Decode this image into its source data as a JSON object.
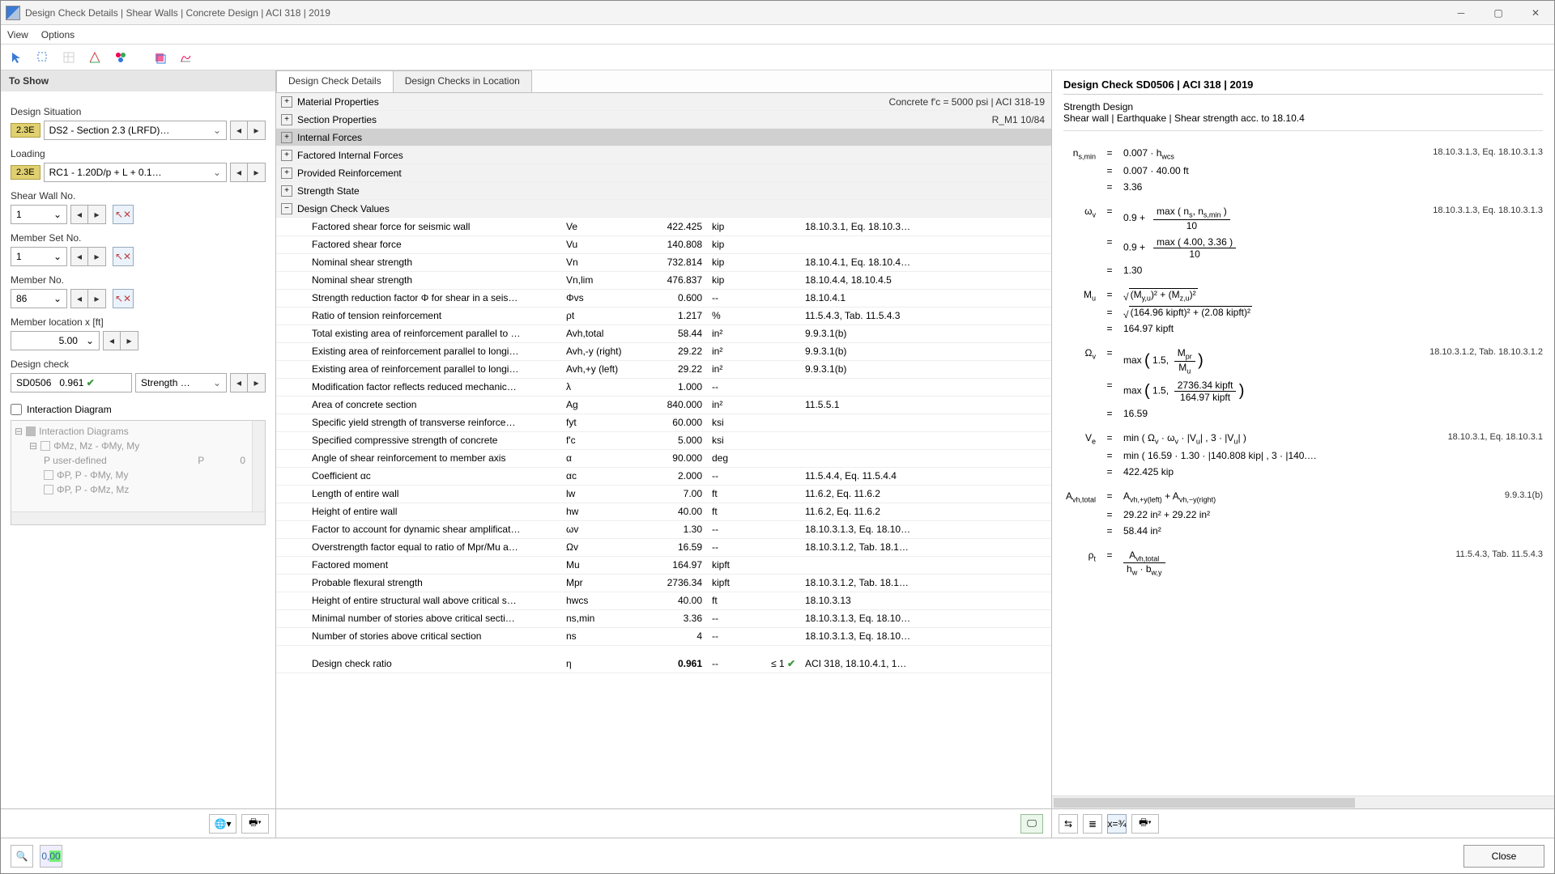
{
  "title": "Design Check Details | Shear Walls | Concrete Design | ACI 318 | 2019",
  "menu": {
    "view": "View",
    "options": "Options"
  },
  "left": {
    "header": "To Show",
    "design_situation_label": "Design Situation",
    "design_situation_badge": "2.3E",
    "design_situation": "DS2 - Section 2.3 (LRFD)…",
    "loading_label": "Loading",
    "loading_badge": "2.3E",
    "loading": "RC1 - 1.20D/p + L + 0.1…",
    "shear_wall_no_label": "Shear Wall No.",
    "shear_wall_no": "1",
    "member_set_no_label": "Member Set No.",
    "member_set_no": "1",
    "member_no_label": "Member No.",
    "member_no": "86",
    "member_location_label": "Member location x [ft]",
    "member_location": "5.00",
    "design_check_label": "Design check",
    "design_check_code": "SD0506",
    "design_check_ratio": "0.961",
    "design_check_name": "Strength …",
    "interaction_diagram_label": "Interaction Diagram",
    "tree": [
      "Interaction Diagrams",
      "ΦMz, Mz - ΦMy, My",
      "P user-defined",
      "ΦP, P - ΦMy, My",
      "ΦP, P - ΦMz, Mz"
    ],
    "tree_p": "P",
    "tree_0": "0"
  },
  "mid": {
    "tab1": "Design Check Details",
    "tab2": "Design Checks in Location",
    "sections": [
      {
        "name": "Material Properties",
        "tail": "Concrete f'c = 5000 psi | ACI 318-19",
        "exp": "+"
      },
      {
        "name": "Section Properties",
        "tail": "R_M1 10/84",
        "exp": "+"
      },
      {
        "name": "Internal Forces",
        "tail": "",
        "exp": "+",
        "sel": true
      },
      {
        "name": "Factored Internal Forces",
        "tail": "",
        "exp": "+"
      },
      {
        "name": "Provided Reinforcement",
        "tail": "",
        "exp": "+"
      },
      {
        "name": "Strength State",
        "tail": "",
        "exp": "+"
      },
      {
        "name": "Design Check Values",
        "tail": "",
        "exp": "−"
      }
    ],
    "rows": [
      {
        "label": "Factored shear force for seismic wall",
        "sym": "Ve",
        "val": "422.425",
        "unit": "kip",
        "ref": "18.10.3.1, Eq. 18.10.3…"
      },
      {
        "label": "Factored shear force",
        "sym": "Vu",
        "val": "140.808",
        "unit": "kip",
        "ref": ""
      },
      {
        "label": "Nominal shear strength",
        "sym": "Vn",
        "val": "732.814",
        "unit": "kip",
        "ref": "18.10.4.1, Eq. 18.10.4…"
      },
      {
        "label": "Nominal shear strength",
        "sym": "Vn,lim",
        "val": "476.837",
        "unit": "kip",
        "ref": "18.10.4.4, 18.10.4.5"
      },
      {
        "label": "Strength reduction factor Φ for shear in a seis…",
        "sym": "Φvs",
        "val": "0.600",
        "unit": "--",
        "ref": "18.10.4.1"
      },
      {
        "label": "Ratio of tension reinforcement",
        "sym": "ρt",
        "val": "1.217",
        "unit": "%",
        "ref": "11.5.4.3, Tab. 11.5.4.3"
      },
      {
        "label": "Total existing area of reinforcement parallel to …",
        "sym": "Avh,total",
        "val": "58.44",
        "unit": "in²",
        "ref": "9.9.3.1(b)"
      },
      {
        "label": "Existing area of reinforcement parallel to longi…",
        "sym": "Avh,-y (right)",
        "val": "29.22",
        "unit": "in²",
        "ref": "9.9.3.1(b)"
      },
      {
        "label": "Existing area of reinforcement parallel to longi…",
        "sym": "Avh,+y (left)",
        "val": "29.22",
        "unit": "in²",
        "ref": "9.9.3.1(b)"
      },
      {
        "label": "Modification factor reflects reduced mechanic…",
        "sym": "λ",
        "val": "1.000",
        "unit": "--",
        "ref": ""
      },
      {
        "label": "Area of concrete section",
        "sym": "Ag",
        "val": "840.000",
        "unit": "in²",
        "ref": "11.5.5.1"
      },
      {
        "label": "Specific yield strength of transverse reinforce…",
        "sym": "fyt",
        "val": "60.000",
        "unit": "ksi",
        "ref": ""
      },
      {
        "label": "Specified compressive strength of concrete",
        "sym": "f'c",
        "val": "5.000",
        "unit": "ksi",
        "ref": ""
      },
      {
        "label": "Angle of shear reinforcement to member axis",
        "sym": "α",
        "val": "90.000",
        "unit": "deg",
        "ref": ""
      },
      {
        "label": "Coefficient αc",
        "sym": "αc",
        "val": "2.000",
        "unit": "--",
        "ref": "11.5.4.4, Eq. 11.5.4.4"
      },
      {
        "label": "Length of entire wall",
        "sym": "lw",
        "val": "7.00",
        "unit": "ft",
        "ref": "11.6.2, Eq. 11.6.2"
      },
      {
        "label": "Height of entire wall",
        "sym": "hw",
        "val": "40.00",
        "unit": "ft",
        "ref": "11.6.2, Eq. 11.6.2"
      },
      {
        "label": "Factor to account for dynamic shear amplificat…",
        "sym": "ωv",
        "val": "1.30",
        "unit": "--",
        "ref": "18.10.3.1.3, Eq. 18.10…"
      },
      {
        "label": "Overstrength factor equal to ratio of Mpr/Mu a…",
        "sym": "Ωv",
        "val": "16.59",
        "unit": "--",
        "ref": "18.10.3.1.2, Tab. 18.1…"
      },
      {
        "label": "Factored moment",
        "sym": "Mu",
        "val": "164.97",
        "unit": "kipft",
        "ref": ""
      },
      {
        "label": "Probable flexural strength",
        "sym": "Mpr",
        "val": "2736.34",
        "unit": "kipft",
        "ref": "18.10.3.1.2, Tab. 18.1…"
      },
      {
        "label": "Height of entire structural wall above critical s…",
        "sym": "hwcs",
        "val": "40.00",
        "unit": "ft",
        "ref": "18.10.3.13"
      },
      {
        "label": "Minimal number of stories above critical secti…",
        "sym": "ns,min",
        "val": "3.36",
        "unit": "--",
        "ref": "18.10.3.1.3, Eq. 18.10…"
      },
      {
        "label": "Number of stories above critical section",
        "sym": "ns",
        "val": "4",
        "unit": "--",
        "ref": "18.10.3.1.3, Eq. 18.10…"
      }
    ],
    "ratio": {
      "label": "Design check ratio",
      "sym": "η",
      "val": "0.961",
      "unit": "--",
      "lim": "≤ 1",
      "ref": "ACI 318, 18.10.4.1, 1…"
    }
  },
  "right": {
    "title": "Design Check SD0506 | ACI 318 | 2019",
    "sub1": "Strength Design",
    "sub2": "Shear wall | Earthquake | Shear strength acc. to 18.10.4",
    "eq_nsmin": {
      "ref": "18.10.3.1.3, Eq. 18.10.3.1.3",
      "l1": "0.007  ·  h",
      "l1_sub": "wcs",
      "l2": "0.007  ·  40.00 ft",
      "l3": "3.36"
    },
    "eq_wv": {
      "ref": "18.10.3.1.3, Eq. 18.10.3.1.3",
      "pre": "0.9  +",
      "num1": "max ( n",
      "sub1": "s",
      "sub1b": "s,min",
      "num1b": ",  n",
      "num1c": " )",
      "den1": "10",
      "num2": "max ( 4.00,  3.36 )",
      "den2": "10",
      "res": "1.30"
    },
    "eq_mu": {
      "l1a": "(M",
      "l1as": "y,u",
      "l1b": ")²   +   (M",
      "l1bs": "z,u",
      "l1c": ")²",
      "l2": "(164.96 kipft)²   +   (2.08 kipft)²",
      "res": "164.97 kipft"
    },
    "eq_ov": {
      "ref": "18.10.3.1.2, Tab. 18.10.3.1.2",
      "pre": "max",
      "num1": "M",
      "num1s": "pr",
      "den1": "M",
      "den1s": "u",
      "num2": "2736.34 kipft",
      "den2": "164.97 kipft",
      "res": "16.59",
      "cons": "1.5,"
    },
    "eq_ve": {
      "ref": "18.10.3.1, Eq. 18.10.3.1",
      "l1": "min ( Ω",
      "l1a": "v",
      "l1b": "  ·  ω",
      "l1c": "v",
      "l1d": "  ·  |V",
      "l1e": "u",
      "l1f": "| ,  3  ·  |V",
      "l1g": "u",
      "l1h": "| )",
      "l2": "min ( 16.59  ·  1.30  ·  |140.808 kip| ,  3  ·  |140.…",
      "res": "422.425 kip"
    },
    "eq_avh": {
      "ref": "9.9.3.1(b)",
      "l1": "A",
      "l1a": "vh,+y(left)",
      "l1b": "   +   A",
      "l1c": "vh,−y(right)",
      "l2": "29.22 in²   +   29.22 in²",
      "res": "58.44 in²"
    },
    "eq_rhot": {
      "ref": "11.5.4.3, Tab. 11.5.4.3",
      "num": "A",
      "nums": "vh,total",
      "den": "h",
      "dens": "w",
      "denb": "  ·   b",
      "denbs": "w,y"
    }
  },
  "close": "Close"
}
